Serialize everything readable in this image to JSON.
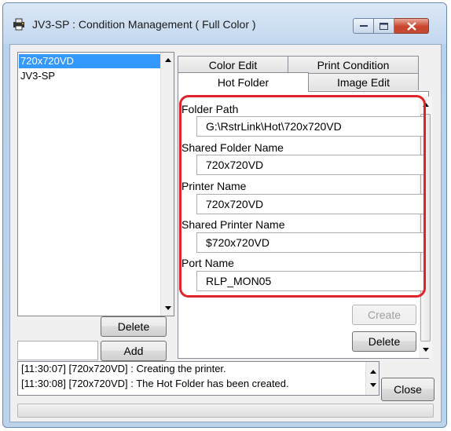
{
  "window": {
    "title": "JV3-SP : Condition Management ( Full Color )",
    "icon": "printer-app-icon"
  },
  "conditions": {
    "items": [
      "720x720VD",
      "JV3-SP"
    ],
    "selected": "720x720VD",
    "delete_label": "Delete",
    "add_label": "Add",
    "new_name_value": ""
  },
  "tabs": {
    "row1": [
      "Color Edit",
      "Print Condition"
    ],
    "row2": [
      "Hot Folder",
      "Image Edit"
    ],
    "active": "Hot Folder"
  },
  "hot_folder": {
    "fields": [
      {
        "label": "Folder Path",
        "value": "G:\\RstrLink\\Hot\\720x720VD"
      },
      {
        "label": "Shared Folder Name",
        "value": "720x720VD"
      },
      {
        "label": "Printer Name",
        "value": "720x720VD"
      },
      {
        "label": "Shared Printer Name",
        "value": "$720x720VD"
      },
      {
        "label": "Port Name",
        "value": "RLP_MON05"
      }
    ],
    "create_label": "Create",
    "delete_label": "Delete"
  },
  "log": {
    "lines": [
      "[11:30:07] [720x720VD] : Creating the printer.",
      "[11:30:08] [720x720VD] : The Hot Folder has been created."
    ]
  },
  "close_label": "Close",
  "colors": {
    "selection": "#3399ff",
    "highlight": "#e2222a",
    "close_button": "#c9442c"
  }
}
